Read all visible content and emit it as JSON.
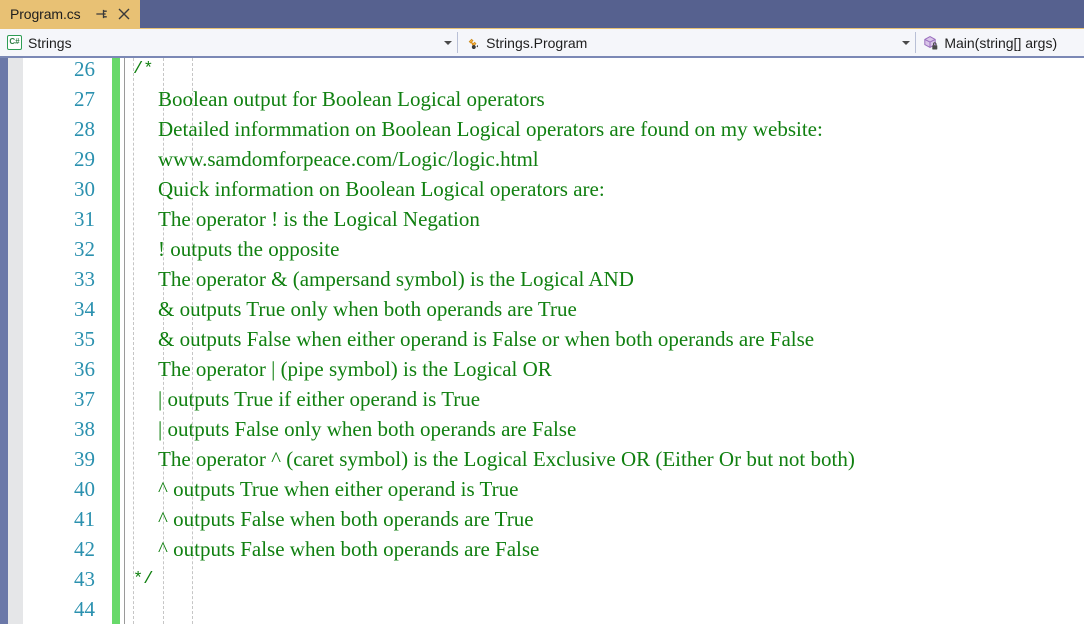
{
  "tab": {
    "title": "Program.cs",
    "pin_icon": "pin-icon",
    "close_icon": "close-icon"
  },
  "nav_bar": {
    "project": {
      "icon": "csharp-file-icon",
      "icon_label": "C#",
      "label": "Strings"
    },
    "type": {
      "icon": "class-icon",
      "label": "Strings.Program"
    },
    "member": {
      "icon": "method-private-icon",
      "label": "Main(string[] args)"
    }
  },
  "editor": {
    "first_line_number": 26,
    "line_numbers": [
      26,
      27,
      28,
      29,
      30,
      31,
      32,
      33,
      34,
      35,
      36,
      37,
      38,
      39,
      40,
      41,
      42,
      43,
      44
    ],
    "colors": {
      "comment": "#108010",
      "line_number": "#2b91af",
      "change_bar": "#68d96a",
      "tab_active": "#e8c174",
      "title_bar": "#56618f"
    },
    "lines": [
      {
        "number": 26,
        "indent": 8,
        "style": "mono",
        "text": "/*"
      },
      {
        "number": 27,
        "indent": 33,
        "style": "serif",
        "text": "Boolean output for Boolean Logical operators"
      },
      {
        "number": 28,
        "indent": 33,
        "style": "serif",
        "text": "Detailed informmation on Boolean Logical operators are found on my website:"
      },
      {
        "number": 29,
        "indent": 33,
        "style": "serif",
        "text": "www.samdomforpeace.com/Logic/logic.html"
      },
      {
        "number": 30,
        "indent": 33,
        "style": "serif",
        "text": "Quick information on Boolean Logical operators are:"
      },
      {
        "number": 31,
        "indent": 33,
        "style": "serif",
        "text": "The operator ! is the Logical Negation"
      },
      {
        "number": 32,
        "indent": 33,
        "style": "serif",
        "text": "! outputs the opposite"
      },
      {
        "number": 33,
        "indent": 33,
        "style": "serif",
        "text": "The operator & (ampersand symbol) is the Logical AND"
      },
      {
        "number": 34,
        "indent": 33,
        "style": "serif",
        "text": "& outputs True only when both operands are True"
      },
      {
        "number": 35,
        "indent": 33,
        "style": "serif",
        "text": "& outputs False when either operand is False or when both operands are False"
      },
      {
        "number": 36,
        "indent": 33,
        "style": "serif",
        "text": "The operator | (pipe symbol) is the Logical OR"
      },
      {
        "number": 37,
        "indent": 33,
        "style": "serif",
        "text": "| outputs True if either operand is True"
      },
      {
        "number": 38,
        "indent": 33,
        "style": "serif",
        "text": "| outputs False only when both operands are False"
      },
      {
        "number": 39,
        "indent": 33,
        "style": "serif",
        "text": "The operator ^ (caret symbol) is the Logical Exclusive OR (Either Or but not both)"
      },
      {
        "number": 40,
        "indent": 33,
        "style": "serif",
        "text": "^ outputs True when either operand is True"
      },
      {
        "number": 41,
        "indent": 33,
        "style": "serif",
        "text": "^ outputs False when both operands are True"
      },
      {
        "number": 42,
        "indent": 33,
        "style": "serif",
        "text": "^ outputs False when both operands are False"
      },
      {
        "number": 43,
        "indent": 8,
        "style": "mono",
        "text": "*/"
      },
      {
        "number": 44,
        "indent": 8,
        "style": "mono",
        "text": ""
      }
    ]
  }
}
